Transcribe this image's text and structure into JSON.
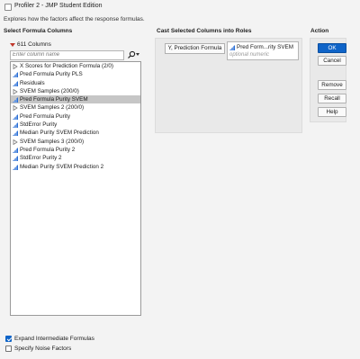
{
  "window": {
    "title": "Profiler 2 - JMP Student Edition"
  },
  "subtitle": "Explores how the factors affect the response formulas.",
  "left": {
    "heading": "Select Formula Columns",
    "count_label": "611 Columns",
    "filter_placeholder": "Enter column name",
    "items": [
      {
        "label": "X Scores for Prediction Formula (2/0)",
        "icon": "group-icon",
        "selected": false
      },
      {
        "label": "Pred Formula Purity PLS",
        "icon": "continuous-formula-icon",
        "selected": false
      },
      {
        "label": "Residuals",
        "icon": "continuous-formula-icon",
        "selected": false
      },
      {
        "label": "SVEM Samples (200/0)",
        "icon": "group-icon",
        "selected": false
      },
      {
        "label": "Pred Formula Purity SVEM",
        "icon": "continuous-formula-icon",
        "selected": true
      },
      {
        "label": "SVEM Samples 2 (200/0)",
        "icon": "group-icon",
        "selected": false
      },
      {
        "label": "Pred Formula Purity",
        "icon": "continuous-formula-icon",
        "selected": false
      },
      {
        "label": "StdError Purity",
        "icon": "continuous-formula-icon",
        "selected": false
      },
      {
        "label": "Median Purity SVEM Prediction",
        "icon": "continuous-formula-icon",
        "selected": false
      },
      {
        "label": "SVEM Samples 3 (200/0)",
        "icon": "group-icon",
        "selected": false
      },
      {
        "label": "Pred Formula Purity 2",
        "icon": "continuous-formula-icon",
        "selected": false
      },
      {
        "label": "StdError Purity 2",
        "icon": "continuous-formula-icon",
        "selected": false
      },
      {
        "label": "Median Purity SVEM Prediction 2",
        "icon": "continuous-formula-icon",
        "selected": false
      }
    ]
  },
  "roles": {
    "heading": "Cast Selected Columns into Roles",
    "button_label": "Y, Prediction Formula",
    "assigned_label": "Pred Form...rity SVEM",
    "optional_label": "optional numeric"
  },
  "action": {
    "heading": "Action",
    "ok": "OK",
    "cancel": "Cancel",
    "remove": "Remove",
    "recall": "Recall",
    "help": "Help"
  },
  "options": {
    "expand_label": "Expand Intermediate Formulas",
    "expand_checked": true,
    "noise_label": "Specify Noise Factors",
    "noise_checked": false
  },
  "colors": {
    "accent": "#0f64c8",
    "selection": "#c6c6c6",
    "count_triangle": "#c0392b"
  }
}
